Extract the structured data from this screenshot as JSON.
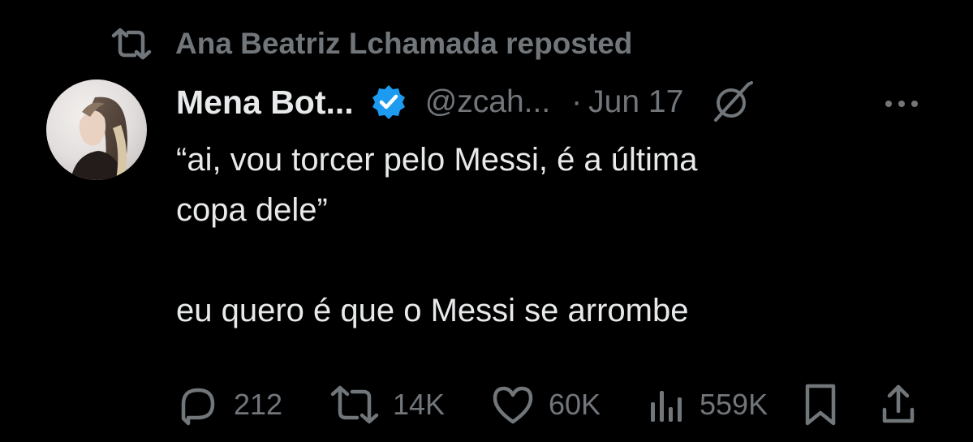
{
  "repost": {
    "text": "Ana Beatriz Lchamada reposted",
    "icon": "repost-icon"
  },
  "author": {
    "name": "Mena Bot...",
    "handle": "@zcah...",
    "separator": "·",
    "date": "Jun 17",
    "verified": true,
    "verified_color": "#1d9bf0"
  },
  "tweet": {
    "line1": "“ai, vou torcer pelo Messi, é a última",
    "line2": "copa dele”",
    "line3": "eu quero é que o Messi se arrombe"
  },
  "actions": {
    "replies": "212",
    "reposts": "14K",
    "likes": "60K",
    "views": "559K"
  },
  "colors": {
    "background": "#000000",
    "text": "#e7e9ea",
    "muted": "#71767b",
    "accent": "#1d9bf0"
  }
}
